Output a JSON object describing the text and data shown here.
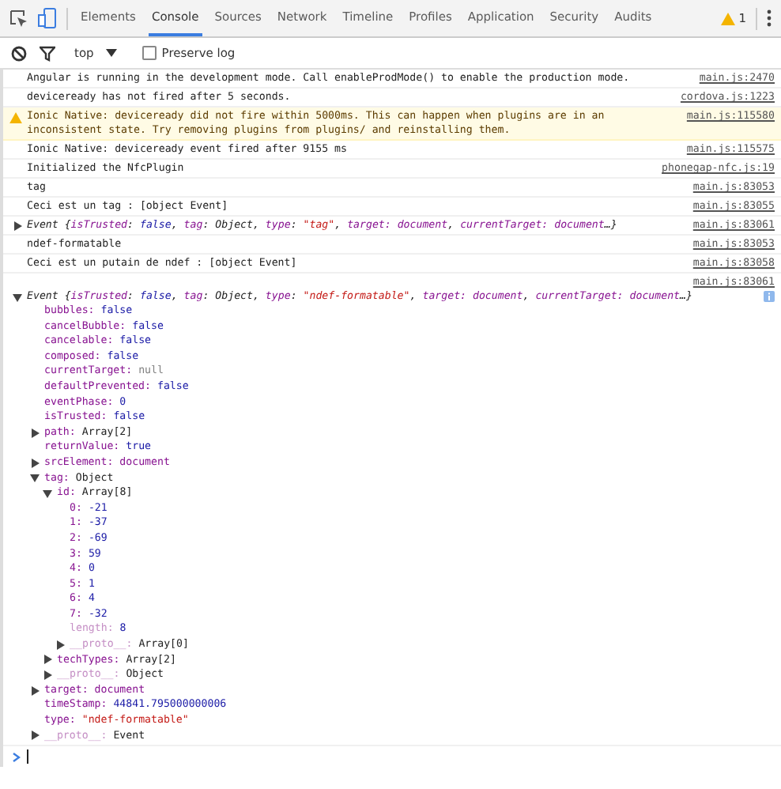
{
  "tabs": [
    {
      "label": "Elements",
      "selected": false
    },
    {
      "label": "Console",
      "selected": true
    },
    {
      "label": "Sources",
      "selected": false
    },
    {
      "label": "Network",
      "selected": false
    },
    {
      "label": "Timeline",
      "selected": false
    },
    {
      "label": "Profiles",
      "selected": false
    },
    {
      "label": "Application",
      "selected": false
    },
    {
      "label": "Security",
      "selected": false
    },
    {
      "label": "Audits",
      "selected": false
    }
  ],
  "warning_count": "1",
  "toolbar": {
    "context": "top",
    "preserve_log": {
      "label": "Preserve log",
      "checked": false
    }
  },
  "messages": [
    {
      "kind": "log",
      "text": "Angular is running in the development mode. Call enableProdMode() to enable the production mode.",
      "source": "main.js:2470"
    },
    {
      "kind": "log",
      "text": "deviceready has not fired after 5 seconds.",
      "source": "cordova.js:1223"
    },
    {
      "kind": "warning",
      "text": "Ionic Native: deviceready did not fire within 5000ms. This can happen when plugins are in an inconsistent state. Try removing plugins from plugins/ and reinstalling them.",
      "source": "main.js:115580"
    },
    {
      "kind": "log",
      "text": "Ionic Native: deviceready event fired after 9155 ms",
      "source": "main.js:115575"
    },
    {
      "kind": "log",
      "text": "Initialized the NfcPlugin",
      "source": "phonegap-nfc.js:19"
    },
    {
      "kind": "log",
      "text": "tag",
      "source": "main.js:83053"
    },
    {
      "kind": "log",
      "text": "Ceci est un tag : [object Event]",
      "source": "main.js:83055"
    },
    {
      "kind": "object",
      "expanded": false,
      "source": "main.js:83061",
      "summary": [
        {
          "t": "Event {",
          "kind": "plain"
        },
        {
          "t": "isTrusted",
          "kind": "key"
        },
        {
          "t": ": ",
          "kind": "plain"
        },
        {
          "t": "false",
          "kind": "bool"
        },
        {
          "t": ", ",
          "kind": "plain"
        },
        {
          "t": "tag",
          "kind": "key"
        },
        {
          "t": ": Object, ",
          "kind": "plain"
        },
        {
          "t": "type",
          "kind": "key"
        },
        {
          "t": ": ",
          "kind": "plain"
        },
        {
          "t": "\"tag\"",
          "kind": "string"
        },
        {
          "t": ", ",
          "kind": "plain"
        },
        {
          "t": "target: document",
          "kind": "key"
        },
        {
          "t": ", ",
          "kind": "plain"
        },
        {
          "t": "currentTarget: document",
          "kind": "key"
        },
        {
          "t": "…}",
          "kind": "plain"
        }
      ]
    },
    {
      "kind": "log",
      "text": "ndef-formatable",
      "source": "main.js:83053"
    },
    {
      "kind": "log",
      "text": "Ceci est un putain de ndef : [object Event]",
      "source": "main.js:83058"
    },
    {
      "kind": "object",
      "expanded": true,
      "source": "main.js:83061",
      "summary": [
        {
          "t": "Event {",
          "kind": "plain"
        },
        {
          "t": "isTrusted",
          "kind": "key"
        },
        {
          "t": ": ",
          "kind": "plain"
        },
        {
          "t": "false",
          "kind": "bool"
        },
        {
          "t": ", ",
          "kind": "plain"
        },
        {
          "t": "tag",
          "kind": "key"
        },
        {
          "t": ": Object, ",
          "kind": "plain"
        },
        {
          "t": "type",
          "kind": "key"
        },
        {
          "t": ": ",
          "kind": "plain"
        },
        {
          "t": "\"ndef-formatable\"",
          "kind": "string"
        },
        {
          "t": ", ",
          "kind": "plain"
        },
        {
          "t": "target: document",
          "kind": "key"
        },
        {
          "t": ", ",
          "kind": "plain"
        },
        {
          "t": "currentTarget: document",
          "kind": "key"
        },
        {
          "t": "…}",
          "kind": "plain"
        }
      ],
      "properties": [
        {
          "name": "bubbles:",
          "value": "false",
          "kind": "bool"
        },
        {
          "name": "cancelBubble:",
          "value": "false",
          "kind": "bool"
        },
        {
          "name": "cancelable:",
          "value": "false",
          "kind": "bool"
        },
        {
          "name": "composed:",
          "value": "false",
          "kind": "bool"
        },
        {
          "name": "currentTarget:",
          "value": "null",
          "kind": "null"
        },
        {
          "name": "defaultPrevented:",
          "value": "false",
          "kind": "bool"
        },
        {
          "name": "eventPhase:",
          "value": "0",
          "kind": "number"
        },
        {
          "name": "isTrusted:",
          "value": "false",
          "kind": "bool"
        },
        {
          "name": "path:",
          "value": "Array[2]",
          "kind": "object",
          "expanded": false
        },
        {
          "name": "returnValue:",
          "value": "true",
          "kind": "bool"
        },
        {
          "name": "srcElement:",
          "value": "document",
          "kind": "node",
          "expanded": false
        },
        {
          "name": "tag:",
          "value": "Object",
          "kind": "object",
          "expanded": true,
          "children": [
            {
              "name": "id:",
              "value": "Array[8]",
              "kind": "object",
              "expanded": true,
              "children": [
                {
                  "name": "0:",
                  "value": "-21",
                  "kind": "number"
                },
                {
                  "name": "1:",
                  "value": "-37",
                  "kind": "number"
                },
                {
                  "name": "2:",
                  "value": "-69",
                  "kind": "number"
                },
                {
                  "name": "3:",
                  "value": "59",
                  "kind": "number"
                },
                {
                  "name": "4:",
                  "value": "0",
                  "kind": "number"
                },
                {
                  "name": "5:",
                  "value": "1",
                  "kind": "number"
                },
                {
                  "name": "6:",
                  "value": "4",
                  "kind": "number"
                },
                {
                  "name": "7:",
                  "value": "-32",
                  "kind": "number"
                },
                {
                  "name": "length:",
                  "value": "8",
                  "kind": "number",
                  "dim": true
                },
                {
                  "name": "__proto__:",
                  "value": "Array[0]",
                  "kind": "object",
                  "expanded": false,
                  "dim": true
                }
              ]
            },
            {
              "name": "techTypes:",
              "value": "Array[2]",
              "kind": "object",
              "expanded": false
            },
            {
              "name": "__proto__:",
              "value": "Object",
              "kind": "object",
              "expanded": false,
              "dim": true
            }
          ]
        },
        {
          "name": "target:",
          "value": "document",
          "kind": "node",
          "expanded": false
        },
        {
          "name": "timeStamp:",
          "value": "44841.795000000006",
          "kind": "number"
        },
        {
          "name": "type:",
          "value": "\"ndef-formatable\"",
          "kind": "string"
        },
        {
          "name": "__proto__:",
          "value": "Event",
          "kind": "object",
          "expanded": false,
          "dim": true
        }
      ]
    }
  ]
}
